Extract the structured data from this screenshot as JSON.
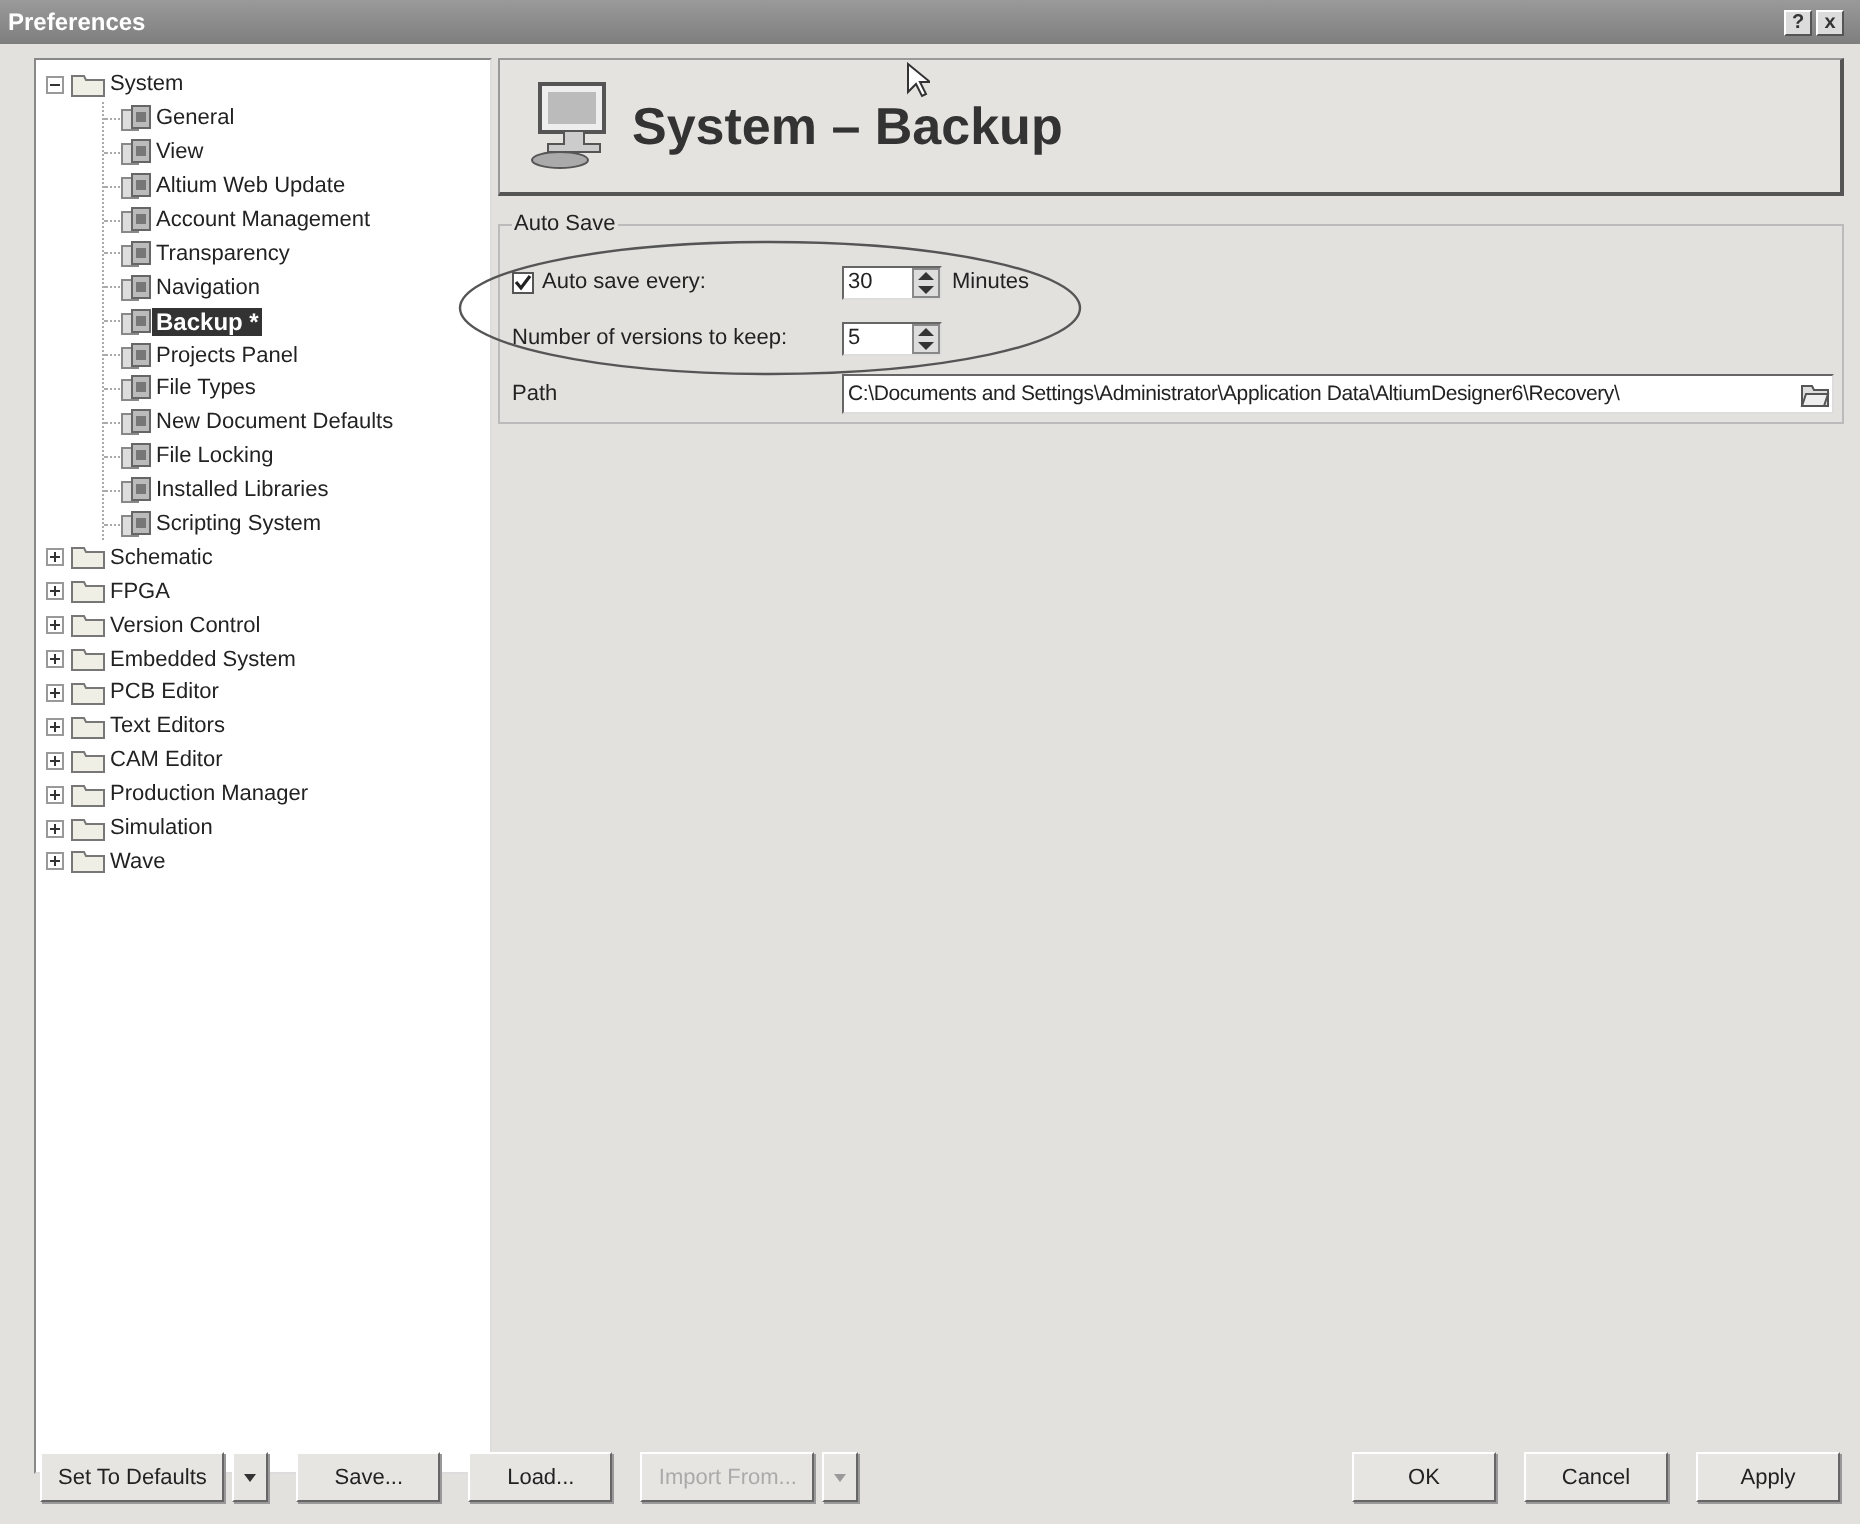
{
  "window": {
    "title": "Preferences",
    "title_buttons": [
      "?",
      "x"
    ]
  },
  "tree": [
    {
      "label": "System",
      "expanded": true,
      "children": [
        {
          "label": "General",
          "selected": false
        },
        {
          "label": "View",
          "selected": false
        },
        {
          "label": "Altium Web Update",
          "selected": false
        },
        {
          "label": "Account Management",
          "selected": false
        },
        {
          "label": "Transparency",
          "selected": false
        },
        {
          "label": "Navigation",
          "selected": false
        },
        {
          "label": "Backup *",
          "selected": true
        },
        {
          "label": "Projects Panel",
          "selected": false
        },
        {
          "label": "File Types",
          "selected": false
        },
        {
          "label": "New Document Defaults",
          "selected": false
        },
        {
          "label": "File Locking",
          "selected": false
        },
        {
          "label": "Installed Libraries",
          "selected": false
        },
        {
          "label": "Scripting System",
          "selected": false
        }
      ]
    },
    {
      "label": "Schematic",
      "expanded": false
    },
    {
      "label": "FPGA",
      "expanded": false
    },
    {
      "label": "Version Control",
      "expanded": false
    },
    {
      "label": "Embedded System",
      "expanded": false
    },
    {
      "label": "PCB Editor",
      "expanded": false
    },
    {
      "label": "Text Editors",
      "expanded": false
    },
    {
      "label": "CAM Editor",
      "expanded": false
    },
    {
      "label": "Production Manager",
      "expanded": false
    },
    {
      "label": "Simulation",
      "expanded": false
    },
    {
      "label": "Wave",
      "expanded": false
    }
  ],
  "page_title": "System – Backup",
  "auto_save": {
    "title": "Auto Save",
    "auto_save_every": {
      "label": "Auto save every:",
      "checked": true,
      "value": "30",
      "unit": "Minutes"
    },
    "versions": {
      "label": "Number of versions to keep:",
      "value": "5"
    },
    "path": {
      "label": "Path",
      "value": "C:\\Documents and Settings\\Administrator\\Application Data\\AltiumDesigner6\\Recovery\\"
    }
  },
  "buttons_left": [
    {
      "label": "Set To Defaults",
      "disabled": false,
      "menu": true
    },
    {
      "label": "Save...",
      "disabled": false,
      "menu": false
    },
    {
      "label": "Load...",
      "disabled": false,
      "menu": false
    },
    {
      "label": "Import From...",
      "disabled": true,
      "menu": true
    }
  ],
  "buttons_right": [
    {
      "label": "OK",
      "disabled": false,
      "menu": false
    },
    {
      "label": "Cancel",
      "disabled": false,
      "menu": false
    },
    {
      "label": "Apply",
      "disabled": false,
      "menu": false
    }
  ]
}
